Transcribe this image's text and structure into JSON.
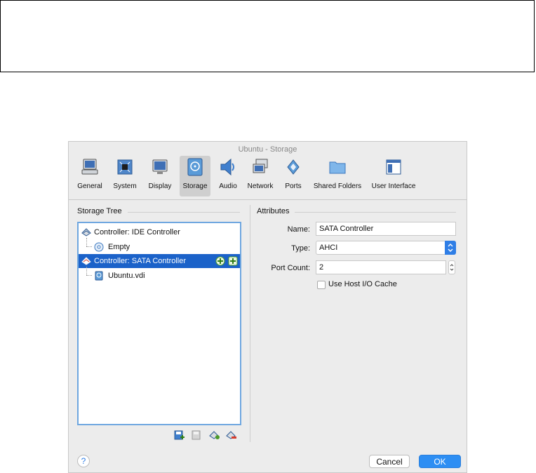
{
  "window": {
    "title": "Ubuntu - Storage"
  },
  "toolbar": {
    "items": [
      {
        "label": "General",
        "icon": "general-icon"
      },
      {
        "label": "System",
        "icon": "system-icon"
      },
      {
        "label": "Display",
        "icon": "display-icon"
      },
      {
        "label": "Storage",
        "icon": "storage-icon",
        "active": true
      },
      {
        "label": "Audio",
        "icon": "audio-icon"
      },
      {
        "label": "Network",
        "icon": "network-icon"
      },
      {
        "label": "Ports",
        "icon": "ports-icon"
      },
      {
        "label": "Shared Folders",
        "icon": "shared-folders-icon"
      },
      {
        "label": "User Interface",
        "icon": "user-interface-icon"
      }
    ]
  },
  "storage_tree": {
    "title": "Storage Tree",
    "rows": [
      {
        "label": "Controller: IDE Controller",
        "icon": "ide-controller-icon"
      },
      {
        "label": "Empty",
        "icon": "optical-disc-icon"
      },
      {
        "label": "Controller: SATA Controller",
        "icon": "sata-controller-icon",
        "selected": true
      },
      {
        "label": "Ubuntu.vdi",
        "icon": "hard-disk-icon"
      }
    ]
  },
  "attributes": {
    "title": "Attributes",
    "name_label": "Name:",
    "name_value": "SATA Controller",
    "type_label": "Type:",
    "type_value": "AHCI",
    "port_count_label": "Port Count:",
    "port_count_value": "2",
    "host_io_cache_label": "Use Host I/O Cache",
    "host_io_cache_checked": false
  },
  "footer": {
    "help": "?",
    "cancel": "Cancel",
    "ok": "OK"
  },
  "colors": {
    "selection": "#1b62c9",
    "accent": "#2d8ef3",
    "dialog_bg": "#ececec"
  }
}
